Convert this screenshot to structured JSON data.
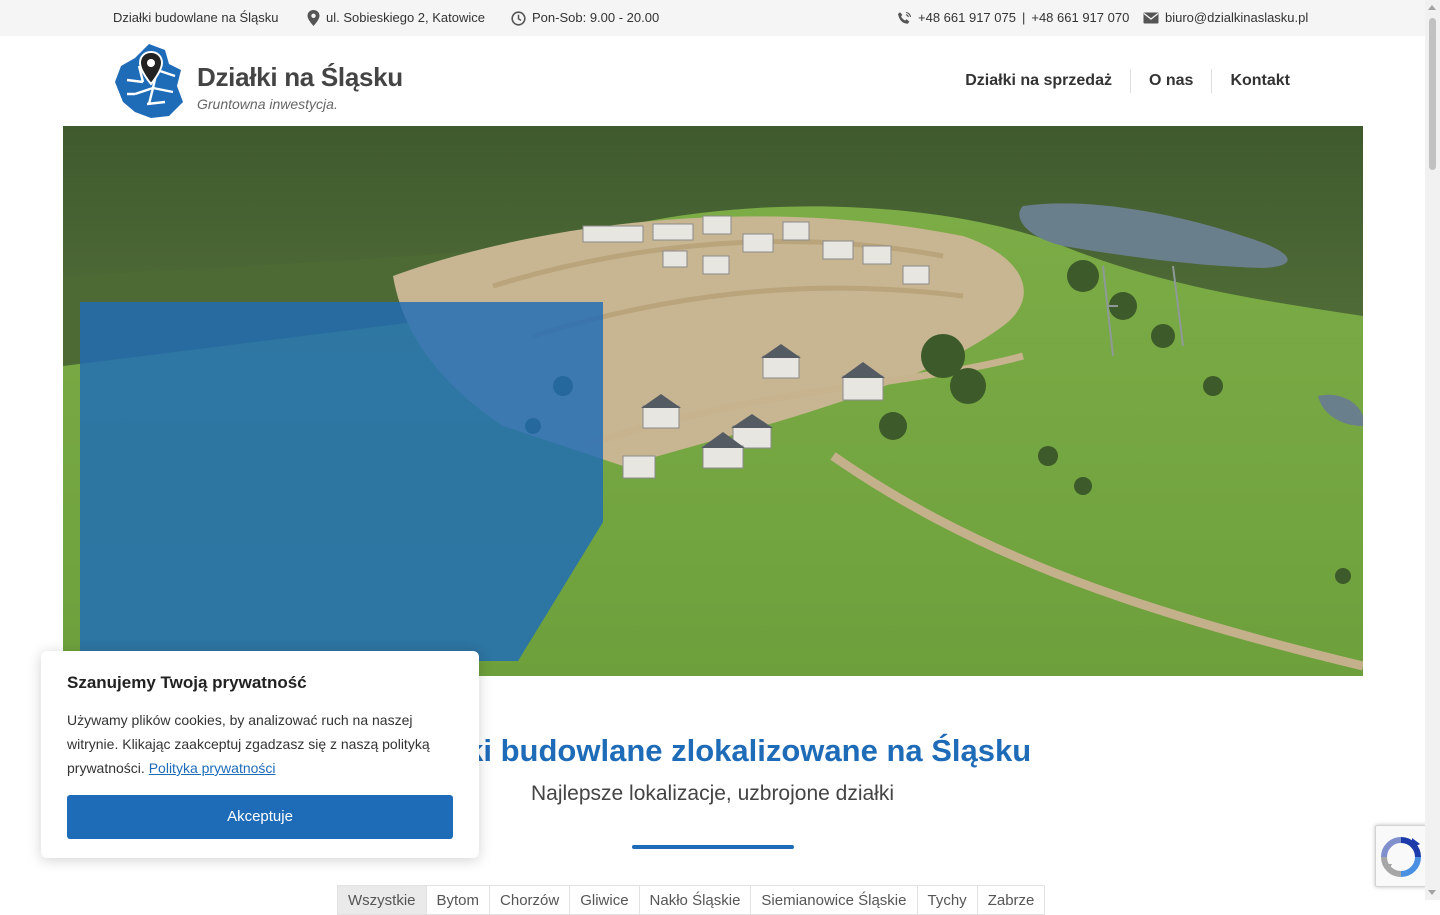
{
  "topbar": {
    "tagline": "Działki budowlane na Śląsku",
    "address": "ul. Sobieskiego 2, Katowice",
    "hours": "Pon-Sob: 9.00 - 20.00",
    "phone1": "+48 661 917 075",
    "phone_separator": "|",
    "phone2": "+48 661 917 070",
    "email": "biuro@dzialkinaslasku.pl"
  },
  "logo": {
    "title": "Działki na Śląsku",
    "subtitle": "Gruntowna inwestycja."
  },
  "nav": {
    "items": [
      {
        "label": "Działki na sprzedaż"
      },
      {
        "label": "O nas"
      },
      {
        "label": "Kontakt"
      }
    ]
  },
  "section": {
    "title": "Działki budowlane zlokalizowane na Śląsku",
    "subtitle": "Najlepsze lokalizacje, uzbrojone działki"
  },
  "filters": {
    "tabs": [
      {
        "label": "Wszystkie"
      },
      {
        "label": "Bytom"
      },
      {
        "label": "Chorzów"
      },
      {
        "label": "Gliwice"
      },
      {
        "label": "Nakło Śląskie"
      },
      {
        "label": "Siemianowice Śląskie"
      },
      {
        "label": "Tychy"
      },
      {
        "label": "Zabrze"
      }
    ]
  },
  "cookie": {
    "title": "Szanujemy Twoją prywatność",
    "text": "Używamy plików cookies, by analizować ruch na naszej witrynie. Klikając zaakceptuj zgadzasz się z naszą polityką prywatności.",
    "link": "Polityka prywatności",
    "button": "Akceptuje"
  },
  "colors": {
    "brand": "#1e6bb8",
    "overlay": "#2a72b5"
  },
  "icons": {
    "address": "map-pin-icon",
    "hours": "clock-icon",
    "phone": "phone-icon",
    "email": "mail-icon",
    "captcha": "recaptcha-icon"
  }
}
